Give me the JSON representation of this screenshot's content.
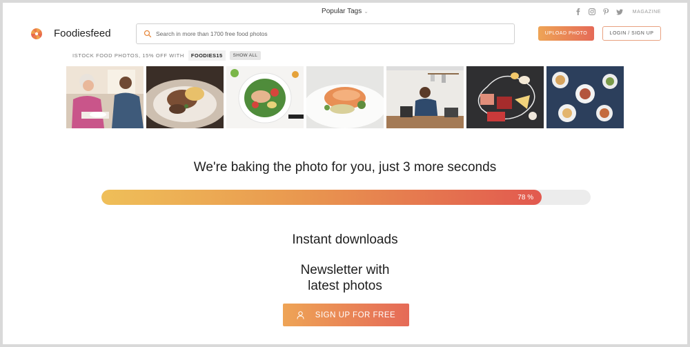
{
  "topbar": {
    "popular_tags": "Popular Tags",
    "magazine": "MAGAZINE",
    "social_icons": [
      "facebook-icon",
      "instagram-icon",
      "pinterest-icon",
      "twitter-icon"
    ]
  },
  "header": {
    "brand": "Foodiesfeed",
    "search_placeholder": "Search in more than 1700 free food photos",
    "upload_label": "UPLOAD PHOTO",
    "login_label": "LOGIN / SIGN UP"
  },
  "promo": {
    "text": "ISTOCK FOOD PHOTOS, 15% OFF WITH",
    "code": "FOODIES15",
    "show_all": "SHOW ALL"
  },
  "photos": [
    {
      "name": "elderly-woman-eating-photo"
    },
    {
      "name": "gourmet-dish-photo"
    },
    {
      "name": "salad-bowl-photo"
    },
    {
      "name": "salmon-plate-photo"
    },
    {
      "name": "man-cooking-kitchen-photo"
    },
    {
      "name": "meat-cheese-board-photo"
    },
    {
      "name": "dinner-table-topview-photo"
    }
  ],
  "loading": {
    "message": "We're baking the photo for you, just 3 more seconds",
    "progress_label": "78 %",
    "progress_fraction": 0.9
  },
  "benefits": {
    "instant": "Instant downloads",
    "newsletter_line1": "Newsletter with",
    "newsletter_line2": "latest photos",
    "signup_label": "SIGN UP FOR FREE"
  },
  "colors": {
    "accent_start": "#eea456",
    "accent_end": "#e56a57"
  }
}
